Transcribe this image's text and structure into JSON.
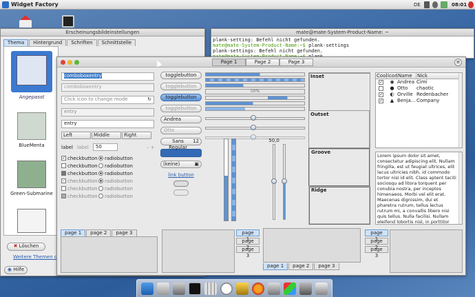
{
  "panel": {
    "title": "Widget Factory",
    "lang": "DE",
    "time": "08:01"
  },
  "appearance": {
    "title": "Erscheinungsbildeinstellungen",
    "tabs": [
      "Thema",
      "Hintergrund",
      "Schriften",
      "Schnittstelle"
    ],
    "themes": [
      "Angepasst",
      "BlueMenta",
      "Green-Submarine"
    ],
    "delete_label": "Löschen",
    "more_link": "Weitere Themen online",
    "help_label": "Hilfe"
  },
  "terminal": {
    "title": "mate@mate-System-Product-Name: ~",
    "lines": [
      {
        "text": "plank-setting: Befehl nicht gefunden."
      },
      {
        "prompt": "mate@mate-System-Product-Name:~$",
        "cmd": " plank-settings"
      },
      {
        "text": "plank-settings: Befehl nicht gefunden."
      },
      {
        "prompt": "mate@mate-System-Product-Name:~$",
        "cmd": " plank"
      }
    ]
  },
  "wf": {
    "pages": [
      "Page 1",
      "Page 2",
      "Page 3"
    ],
    "combo1": "comboboxentry",
    "combo2": "comboboxentry",
    "icon_placeholder": "Click icon to change mode",
    "entry1": "entry",
    "entry2": "entry",
    "align": [
      "Left",
      "Middle",
      "Right"
    ],
    "label1": "label",
    "label2": "label",
    "spin": "50",
    "checks": [
      "checkbutton",
      "checkbutton",
      "checkbutton",
      "checkbutton",
      "checkbutton",
      "checkbutton"
    ],
    "radios": [
      "radiobutton",
      "radiobutton",
      "radiobutton",
      "radiobutton",
      "radiobutton",
      "radiobutton"
    ],
    "toggles": [
      "togglebutton",
      "togglebutton",
      "togglebutton",
      "togglebutton"
    ],
    "combo_andrea": "Andrea",
    "combo_otto": "Otto",
    "font_name": "Sans Regular",
    "font_size": "12",
    "file_none": "(keine)",
    "link": "link button",
    "progress_text": "50%",
    "scale_value": "50,0",
    "frames": [
      "Inset",
      "Outset",
      "Groove",
      "Ridge"
    ],
    "tree_headers": [
      "Cool",
      "Icon",
      "Name",
      "Nick"
    ],
    "tree_rows": [
      {
        "cool": true,
        "name": "Andrea",
        "nick": "Cimi"
      },
      {
        "cool": false,
        "name": "Otto",
        "nick": "chaotic"
      },
      {
        "cool": true,
        "name": "Orville",
        "nick": "Redenbacher"
      },
      {
        "cool": true,
        "name": "Benja...",
        "nick": "Company"
      }
    ],
    "lorem": "Lorem ipsum dolor sit amet, consectetur adipiscing elit. Nullam fringilla, est ut feugiat ultrices, elit lacus ultricies nibh, id commodo tortor nisi id elit. Class aptent taciti sociosqu ad litora torquent per conubia nostra, per inceptos himenaeos. Morbi vel elit erat. Maecenas dignissim, dui et pharetra rutrum, tellus lectus rutrum mi, a convallis libero nisi quis tellus. Nulla facilisi. Nullam eleifend lobortis nisl, in porttitor tellus malesuada vitae. Aenean lacus tellus, pellentesque quis",
    "bottom_tabs": [
      "page 1",
      "page 2",
      "page 3"
    ]
  }
}
